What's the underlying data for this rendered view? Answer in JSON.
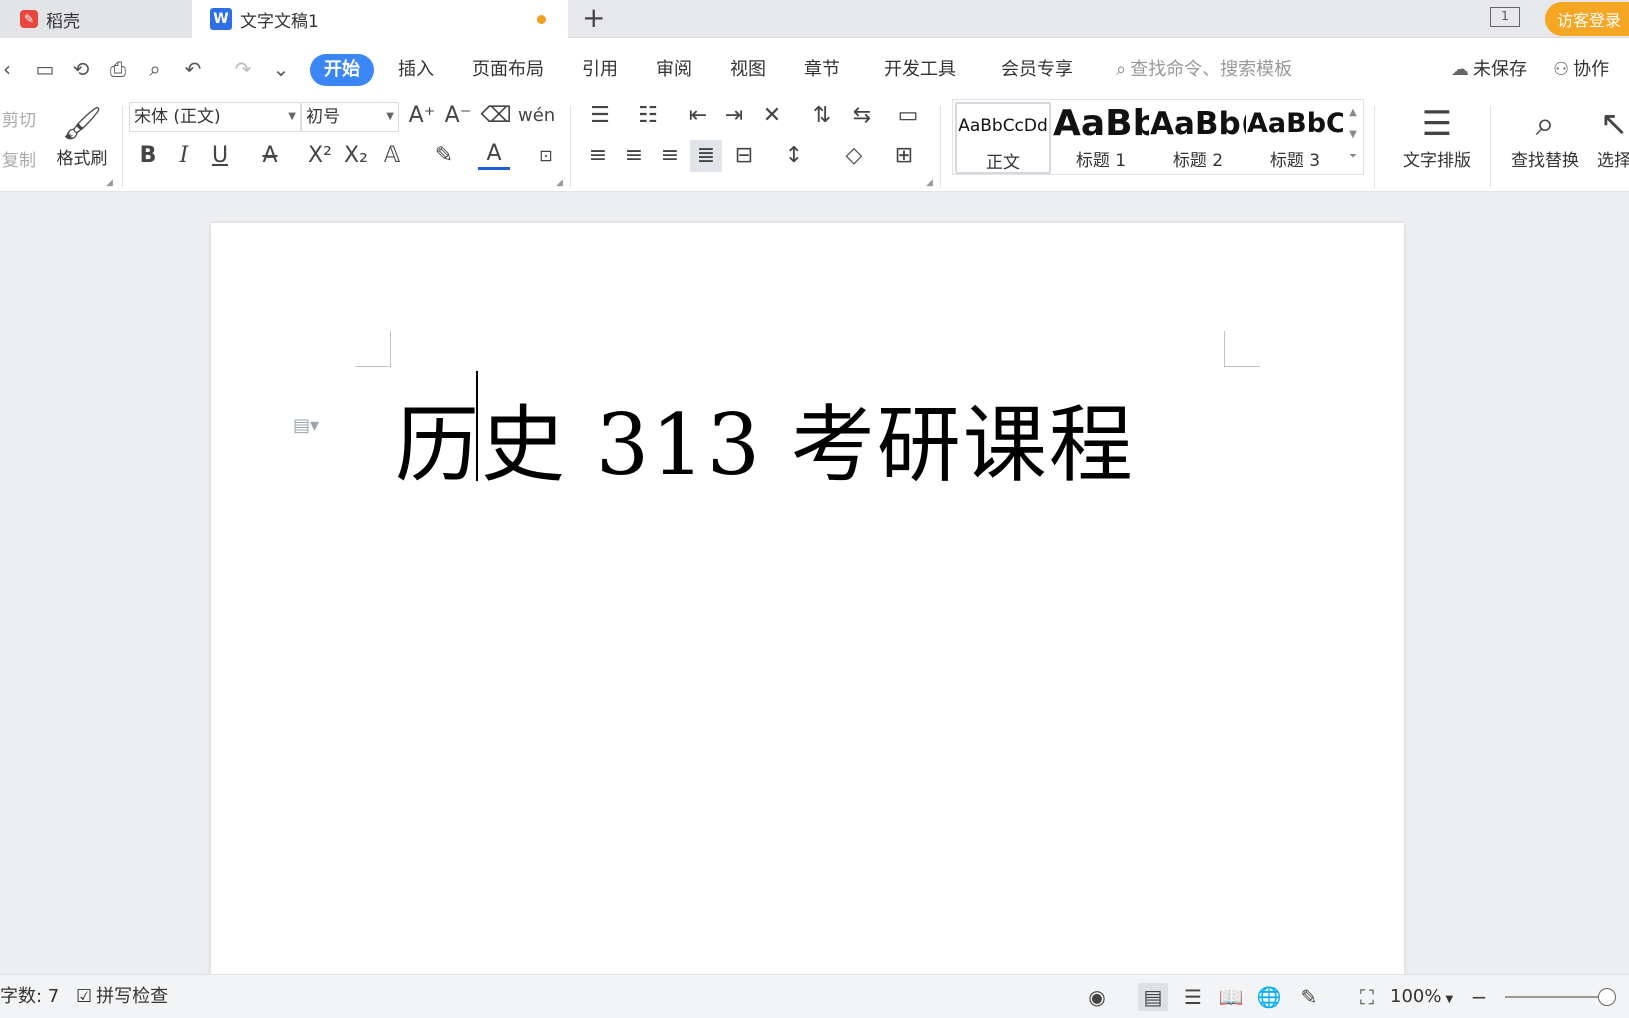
{
  "tabs": [
    {
      "label": "稻壳",
      "active": false
    },
    {
      "label": "文字文稿1",
      "active": true,
      "unsaved": true
    }
  ],
  "titlebar": {
    "new_tab": "+",
    "window_count": "1",
    "visitor_login": "访客登录"
  },
  "menu": {
    "items": [
      "开始",
      "插入",
      "页面布局",
      "引用",
      "审阅",
      "视图",
      "章节",
      "开发工具",
      "会员专享"
    ],
    "active": "开始",
    "search_placeholder": "查找命令、搜索模板",
    "unsaved": "未保存",
    "collaborate": "协作"
  },
  "toolbar": {
    "cut": "剪切",
    "copy": "复制",
    "format_brush": "格式刷",
    "font_name": "宋体 (正文)",
    "font_size": "初号",
    "styles": [
      {
        "preview": "AaBbCcDd",
        "name": "正文"
      },
      {
        "preview": "AaBb",
        "name": "标题 1"
      },
      {
        "preview": "AaBb(",
        "name": "标题 2"
      },
      {
        "preview": "AaBbC",
        "name": "标题 3"
      }
    ],
    "text_layout": "文字排版",
    "find_replace": "查找替换",
    "select": "选择"
  },
  "document": {
    "title_text": "历史 313 考研课程"
  },
  "statusbar": {
    "word_count": "字数: 7",
    "spell_check": "拼写检查",
    "zoom": "100%"
  },
  "colors": {
    "accent": "#3b86f7",
    "visitor": "#f5a623",
    "unsaved_dot": "#f0a020",
    "font_color_underline": "#1e5fd8"
  }
}
